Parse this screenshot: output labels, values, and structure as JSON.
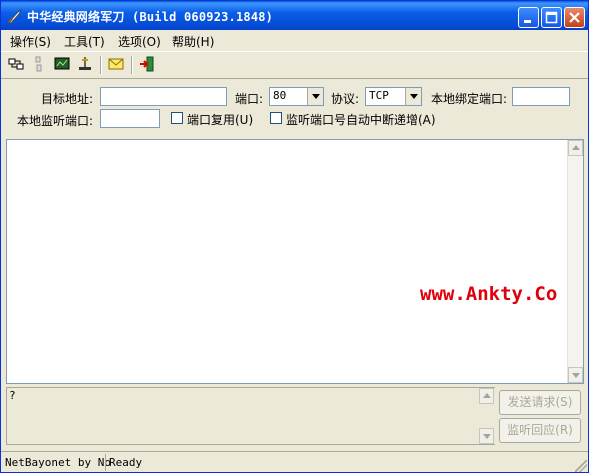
{
  "window": {
    "title": "中华经典网络军刀 (Build 060923.1848)"
  },
  "menu": [
    {
      "label": "操作(S)"
    },
    {
      "label": "工具(T)"
    },
    {
      "label": "选项(O)"
    },
    {
      "label": "帮助(H)"
    }
  ],
  "toolbar": {
    "icons": [
      "connect-icon",
      "disconnect-icon",
      "monitor-icon",
      "tool-icon",
      "mail-icon",
      "exit-icon"
    ]
  },
  "form": {
    "target_addr_label": "目标地址:",
    "target_addr_value": "",
    "port_label": "端口:",
    "port_value": "80",
    "protocol_label": "协议:",
    "protocol_value": "TCP",
    "local_bind_port_label": "本地绑定端口:",
    "local_bind_port_value": "",
    "local_listen_port_label": "本地监听端口:",
    "local_listen_port_value": "",
    "port_reuse_label": "端口复用(U)",
    "port_reuse_checked": false,
    "auto_increment_label": "监听端口号自动中断递增(A)",
    "auto_increment_checked": false
  },
  "main": {
    "watermark": "www.Ankty.Co"
  },
  "send": {
    "text": "?",
    "send_button": "发送请求(S)",
    "listen_reply_button": "监听回应(R)"
  },
  "status": {
    "left": "NetBayonet by No",
    "right": "Ready"
  },
  "colors": {
    "titlebar": "#0a5ee6",
    "watermark": "#e0000b",
    "window_bg": "#ece9d8"
  }
}
